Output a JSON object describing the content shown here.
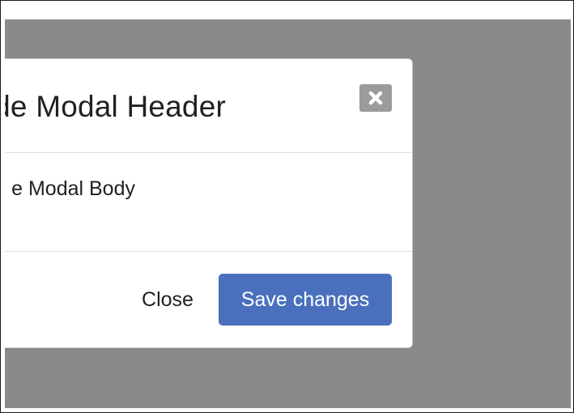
{
  "modal": {
    "title": "de Modal Header",
    "body_text": "e Modal Body",
    "close_icon": "close-x-icon",
    "footer": {
      "close_label": "Close",
      "save_label": "Save changes"
    }
  },
  "colors": {
    "backdrop": "#8a8a8a",
    "primary_button": "#4a70bd",
    "close_icon_bg": "#9b9b9b",
    "divider": "#dedede"
  }
}
